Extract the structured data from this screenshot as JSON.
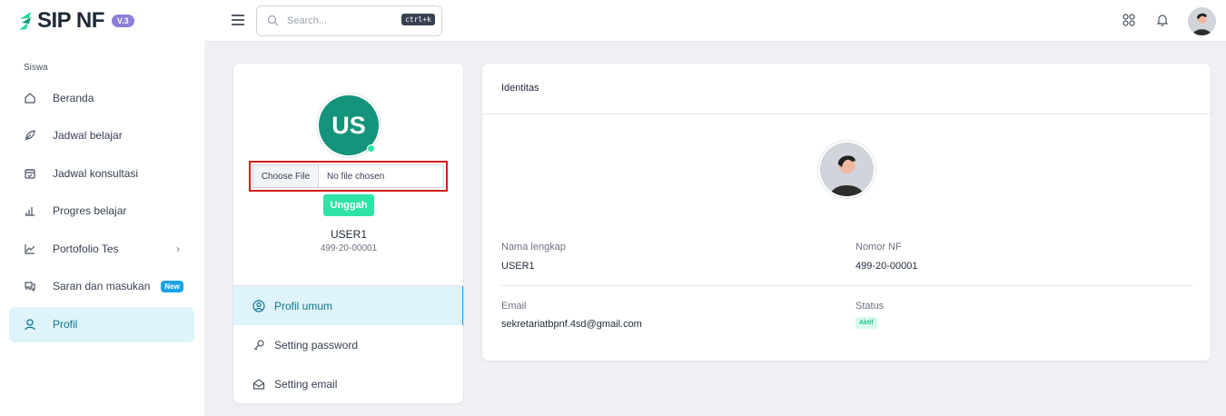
{
  "app": {
    "name": "SIP NF",
    "version": "V.3"
  },
  "sidebar": {
    "section_label": "Siswa",
    "items": [
      {
        "label": "Beranda",
        "icon": "home-icon"
      },
      {
        "label": "Jadwal belajar",
        "icon": "leaf-icon"
      },
      {
        "label": "Jadwal konsultasi",
        "icon": "calendar-check-icon"
      },
      {
        "label": "Progres belajar",
        "icon": "bar-chart-icon"
      },
      {
        "label": "Portofolio Tes",
        "icon": "line-chart-icon"
      },
      {
        "label": "Saran dan masukan",
        "icon": "chat-icon",
        "badge": "New"
      },
      {
        "label": "Profil",
        "icon": "user-icon"
      }
    ]
  },
  "topbar": {
    "search_placeholder": "Search...",
    "shortcut": "ctrl+k"
  },
  "profile": {
    "initials": "US",
    "file_button": "Choose File",
    "file_status": "No file chosen",
    "upload_label": "Unggah",
    "name": "USER1",
    "id": "499-20-00001",
    "nav": [
      {
        "label": "Profil umum",
        "icon": "user-circle-icon"
      },
      {
        "label": "Setting password",
        "icon": "key-icon"
      },
      {
        "label": "Setting email",
        "icon": "envelope-open-icon"
      }
    ]
  },
  "identitas": {
    "title": "Identitas",
    "fields": {
      "nama_label": "Nama lengkap",
      "nama_value": "USER1",
      "nomor_label": "Nomor NF",
      "nomor_value": "499-20-00001",
      "email_label": "Email",
      "email_value": "sekretariatbpnf.4sd@gmail.com",
      "status_label": "Status",
      "status_value": "Aktif"
    }
  },
  "colors": {
    "brand_green": "#14947b",
    "accent_mint": "#2ee3a4",
    "active_bg": "#dff3fa",
    "active_text": "#0e7490",
    "highlight_red": "#d01c1c",
    "version_purple": "#8b7fd6"
  }
}
